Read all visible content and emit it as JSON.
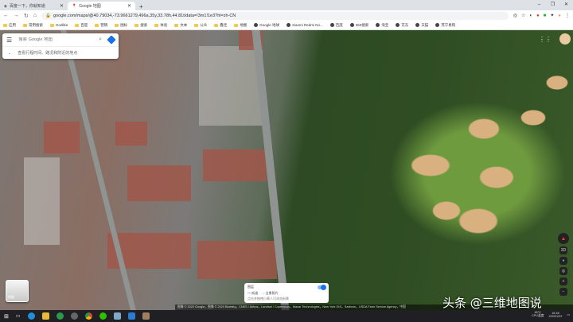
{
  "browser": {
    "tabs": [
      {
        "title": "百度一下，你就知道",
        "active": false
      },
      {
        "title": "Google 地图",
        "active": true
      }
    ],
    "url": "google.com/maps/@40.79034,-73.9661279,496a,35y,33.78h,44.81t/data=!3m1!1e3?hl=zh-CN",
    "bookmarks": [
      "应用",
      "常用搜索",
      "Godlike",
      "百度",
      "营销",
      "图标",
      "搜索",
      "体验",
      "文本",
      "公众",
      "鑫佳",
      "地图",
      "Google 地球",
      "Xiaomi Redmi No...",
      "百度",
      "360搜索",
      "淘宝",
      "京东",
      "天猫",
      "苏宁易购"
    ]
  },
  "search": {
    "placeholder": "搜索 Google 地图",
    "hint": "查看行程时间、路况和附近的地点"
  },
  "controls": {
    "tilt_label": "3D"
  },
  "layers": {
    "label": "地图"
  },
  "tour": {
    "title": "图层",
    "legend_road": "街道",
    "legend_photo": "全景照片",
    "note": "点击并拖拽小黄人可浏览街景"
  },
  "attribution": "图像 © 2020 Google，图像 © 2020 Bluesky，CNES / Airbus，Landsat / Copernicus，Maxar Technologies，New York GIS，Sanborn，USDA Farm Service Agency，中国",
  "watermark": "头条 @三维地图说",
  "tray": {
    "temp": "46°C",
    "temp_label": "CPU温度",
    "time": "16:46",
    "date": "2020/1/22"
  }
}
